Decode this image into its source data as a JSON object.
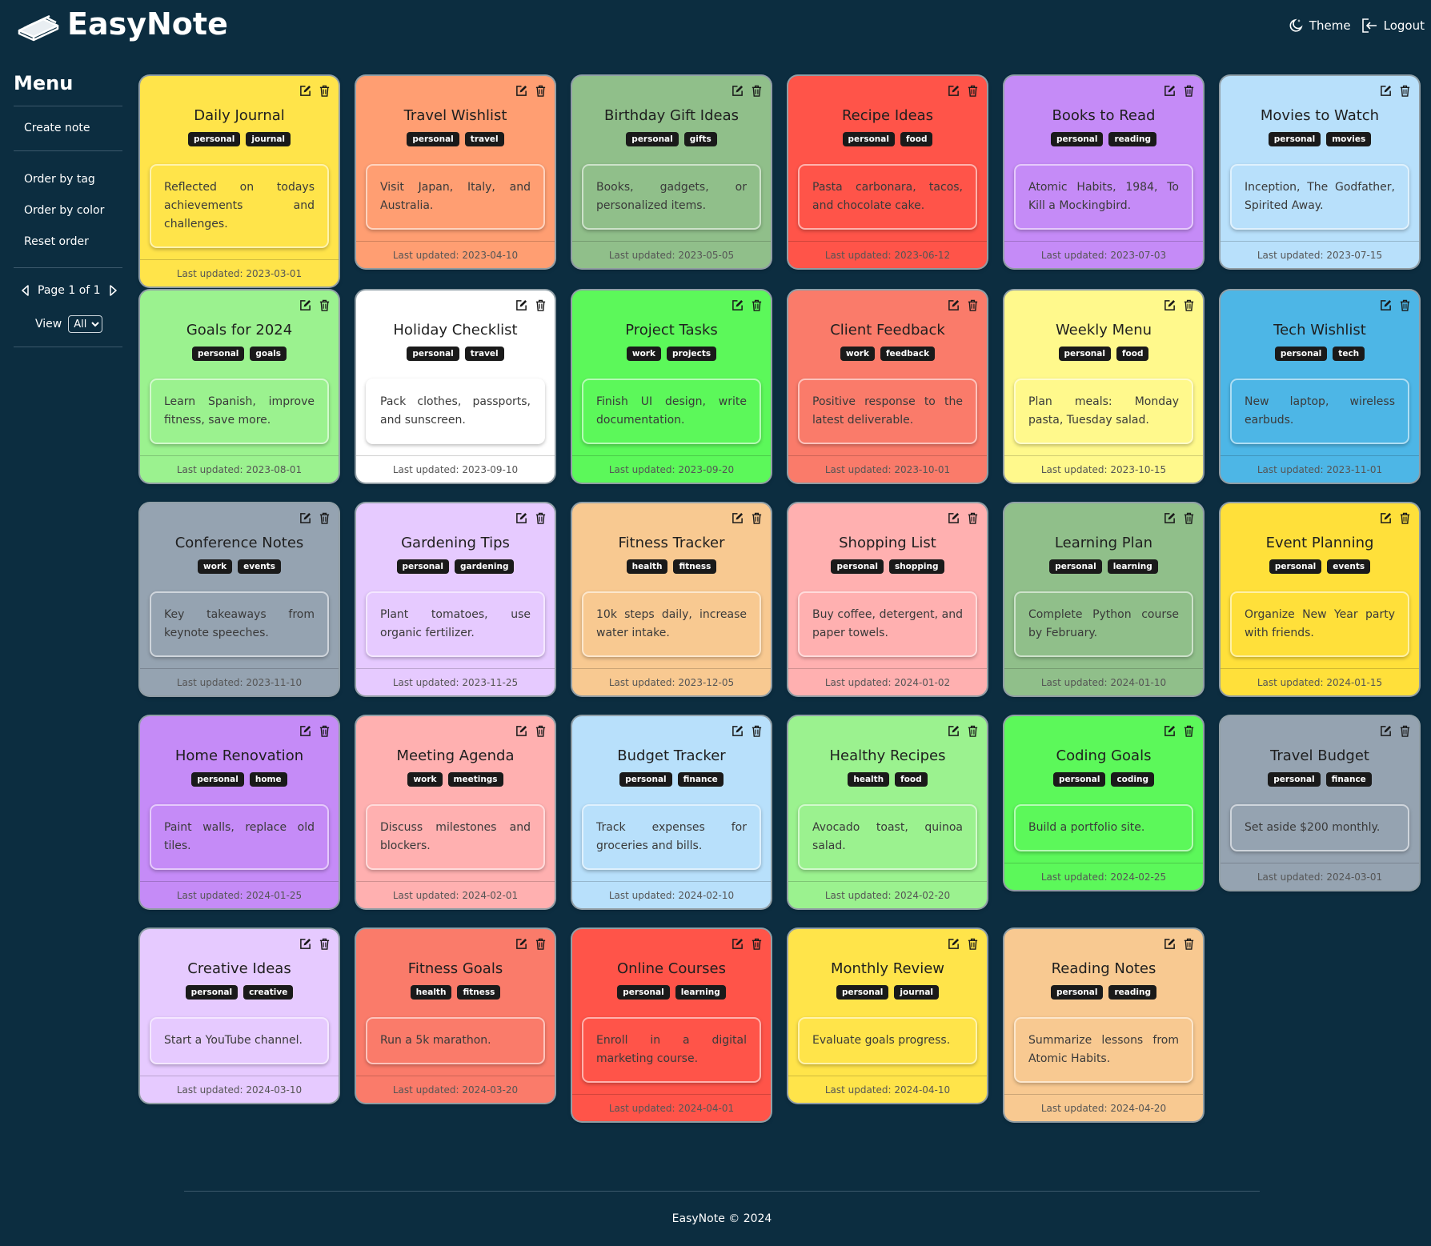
{
  "app": {
    "name": "EasyNote"
  },
  "header": {
    "theme_label": "Theme",
    "logout_label": "Logout"
  },
  "sidebar": {
    "title": "Menu",
    "create_note": "Create note",
    "order_by_tag": "Order by tag",
    "order_by_color": "Order by color",
    "reset_order": "Reset order",
    "page_label": "Page 1 of 1",
    "view_label": "View",
    "view_value": "All"
  },
  "footer": {
    "text": "EasyNote © 2024"
  },
  "notes": [
    {
      "title": "Daily Journal",
      "tags": [
        "personal",
        "journal"
      ],
      "body": "Reflected on todays achievements and challenges.",
      "updated": "Last updated: 2023-03-01",
      "color": "#ffe44a"
    },
    {
      "title": "Travel Wishlist",
      "tags": [
        "personal",
        "travel"
      ],
      "body": "Visit Japan, Italy, and Australia.",
      "updated": "Last updated: 2023-04-10",
      "color": "#ff9e72"
    },
    {
      "title": "Birthday Gift Ideas",
      "tags": [
        "personal",
        "gifts"
      ],
      "body": "Books, gadgets, or personalized items.",
      "updated": "Last updated: 2023-05-05",
      "color": "#90bf8a"
    },
    {
      "title": "Recipe Ideas",
      "tags": [
        "personal",
        "food"
      ],
      "body": "Pasta carbonara, tacos, and chocolate cake.",
      "updated": "Last updated: 2023-06-12",
      "color": "#ff5449"
    },
    {
      "title": "Books to Read",
      "tags": [
        "personal",
        "reading"
      ],
      "body": "Atomic Habits, 1984, To Kill a Mockingbird.",
      "updated": "Last updated: 2023-07-03",
      "color": "#c58bf7"
    },
    {
      "title": "Movies to Watch",
      "tags": [
        "personal",
        "movies"
      ],
      "body": "Inception, The Godfather, Spirited Away.",
      "updated": "Last updated: 2023-07-15",
      "color": "#b8e0fb"
    },
    {
      "title": "Goals for 2024",
      "tags": [
        "personal",
        "goals"
      ],
      "body": "Learn Spanish, improve fitness, save more.",
      "updated": "Last updated: 2023-08-01",
      "color": "#9bf28f"
    },
    {
      "title": "Holiday Checklist",
      "tags": [
        "personal",
        "travel"
      ],
      "body": "Pack clothes, passports, and sunscreen.",
      "updated": "Last updated: 2023-09-10",
      "color": "#ffffff"
    },
    {
      "title": "Project Tasks",
      "tags": [
        "work",
        "projects"
      ],
      "body": "Finish UI design, write documentation.",
      "updated": "Last updated: 2023-09-20",
      "color": "#5cf85a"
    },
    {
      "title": "Client Feedback",
      "tags": [
        "work",
        "feedback"
      ],
      "body": "Positive response to the latest deliverable.",
      "updated": "Last updated: 2023-10-01",
      "color": "#fa7b6a"
    },
    {
      "title": "Weekly Menu",
      "tags": [
        "personal",
        "food"
      ],
      "body": "Plan meals: Monday pasta, Tuesday salad.",
      "updated": "Last updated: 2023-10-15",
      "color": "#fff98c"
    },
    {
      "title": "Tech Wishlist",
      "tags": [
        "personal",
        "tech"
      ],
      "body": "New laptop, wireless earbuds.",
      "updated": "Last updated: 2023-11-01",
      "color": "#4db6e6"
    },
    {
      "title": "Conference Notes",
      "tags": [
        "work",
        "events"
      ],
      "body": "Key takeaways from keynote speeches.",
      "updated": "Last updated: 2023-11-10",
      "color": "#95a3b1"
    },
    {
      "title": "Gardening Tips",
      "tags": [
        "personal",
        "gardening"
      ],
      "body": "Plant tomatoes, use organic fertilizer.",
      "updated": "Last updated: 2023-11-25",
      "color": "#e6caff"
    },
    {
      "title": "Fitness Tracker",
      "tags": [
        "health",
        "fitness"
      ],
      "body": "10k steps daily, increase water intake.",
      "updated": "Last updated: 2023-12-05",
      "color": "#f8c991"
    },
    {
      "title": "Shopping List",
      "tags": [
        "personal",
        "shopping"
      ],
      "body": "Buy coffee, detergent, and paper towels.",
      "updated": "Last updated: 2024-01-02",
      "color": "#ffb0b0"
    },
    {
      "title": "Learning Plan",
      "tags": [
        "personal",
        "learning"
      ],
      "body": "Complete Python course by February.",
      "updated": "Last updated: 2024-01-10",
      "color": "#90bf8a"
    },
    {
      "title": "Event Planning",
      "tags": [
        "personal",
        "events"
      ],
      "body": "Organize New Year party with friends.",
      "updated": "Last updated: 2024-01-15",
      "color": "#ffe03a"
    },
    {
      "title": "Home Renovation",
      "tags": [
        "personal",
        "home"
      ],
      "body": "Paint walls, replace old tiles.",
      "updated": "Last updated: 2024-01-25",
      "color": "#c58bf7"
    },
    {
      "title": "Meeting Agenda",
      "tags": [
        "work",
        "meetings"
      ],
      "body": "Discuss milestones and blockers.",
      "updated": "Last updated: 2024-02-01",
      "color": "#ffb0b0"
    },
    {
      "title": "Budget Tracker",
      "tags": [
        "personal",
        "finance"
      ],
      "body": "Track expenses for groceries and bills.",
      "updated": "Last updated: 2024-02-10",
      "color": "#b8e0fb"
    },
    {
      "title": "Healthy Recipes",
      "tags": [
        "health",
        "food"
      ],
      "body": "Avocado toast, quinoa salad.",
      "updated": "Last updated: 2024-02-20",
      "color": "#9bf28f"
    },
    {
      "title": "Coding Goals",
      "tags": [
        "personal",
        "coding"
      ],
      "body": "Build a portfolio site.",
      "updated": "Last updated: 2024-02-25",
      "color": "#5cf85a"
    },
    {
      "title": "Travel Budget",
      "tags": [
        "personal",
        "finance"
      ],
      "body": "Set aside $200 monthly.",
      "updated": "Last updated: 2024-03-01",
      "color": "#95a3b1"
    },
    {
      "title": "Creative Ideas",
      "tags": [
        "personal",
        "creative"
      ],
      "body": "Start a YouTube channel.",
      "updated": "Last updated: 2024-03-10",
      "color": "#e6caff"
    },
    {
      "title": "Fitness Goals",
      "tags": [
        "health",
        "fitness"
      ],
      "body": "Run a 5k marathon.",
      "updated": "Last updated: 2024-03-20",
      "color": "#fa7b6a"
    },
    {
      "title": "Online Courses",
      "tags": [
        "personal",
        "learning"
      ],
      "body": "Enroll in a digital marketing course.",
      "updated": "Last updated: 2024-04-01",
      "color": "#ff5449"
    },
    {
      "title": "Monthly Review",
      "tags": [
        "personal",
        "journal"
      ],
      "body": "Evaluate goals progress.",
      "updated": "Last updated: 2024-04-10",
      "color": "#ffe44a"
    },
    {
      "title": "Reading Notes",
      "tags": [
        "personal",
        "reading"
      ],
      "body": "Summarize lessons from Atomic Habits.",
      "updated": "Last updated: 2024-04-20",
      "color": "#f8c991"
    }
  ]
}
